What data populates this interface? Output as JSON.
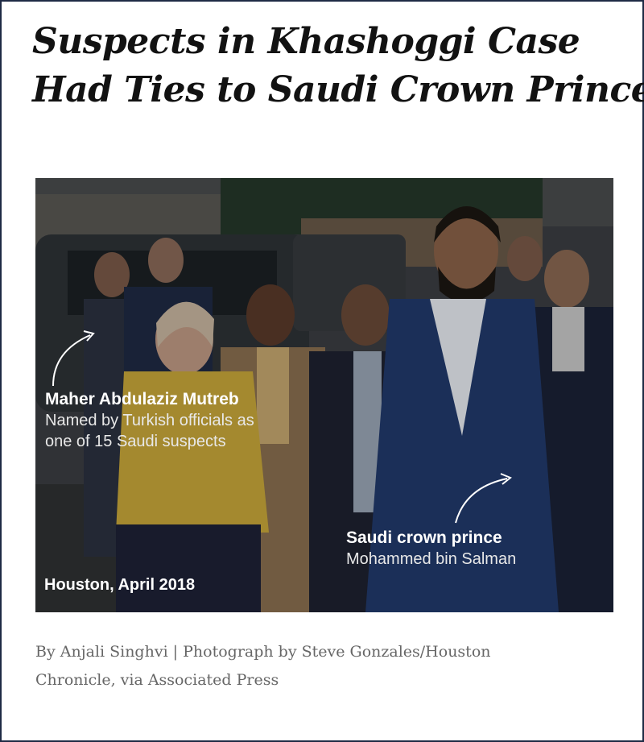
{
  "article": {
    "headline_line1": "Suspects in Khashoggi Case",
    "headline_line2": "Had Ties to Saudi Crown Prince"
  },
  "photo": {
    "annotations": {
      "mutreb": {
        "title": "Maher Abdulaziz Mutreb",
        "line1": "Named by Turkish officials as",
        "line2": "one of 15 Saudi suspects"
      },
      "prince": {
        "title": "Saudi crown prince",
        "subtitle": "Mohammed bin Salman"
      }
    },
    "location": "Houston, April 2018"
  },
  "credit": {
    "line1": "By Anjali Singhvi | Photograph by Steve Gonzales/Houston",
    "line2": "Chronicle, via Associated Press"
  }
}
